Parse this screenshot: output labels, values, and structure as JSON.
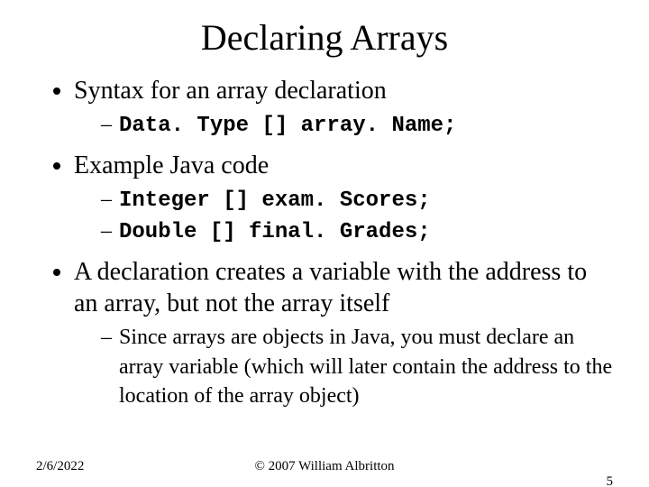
{
  "title": "Declaring Arrays",
  "bullets": {
    "b1": "Syntax for an array declaration",
    "b1_sub1": "Data. Type [] array. Name;",
    "b2": "Example Java code",
    "b2_sub1": "Integer [] exam. Scores;",
    "b2_sub2": "Double [] final. Grades;",
    "b3": "A declaration creates a variable with the address to an array, but not the array itself",
    "b3_sub1": "Since arrays are objects in Java, you must declare an array variable (which will later contain the address to the location of the array object)"
  },
  "footer": {
    "date": "2/6/2022",
    "copyright": "© 2007 William Albritton",
    "page": "5"
  }
}
